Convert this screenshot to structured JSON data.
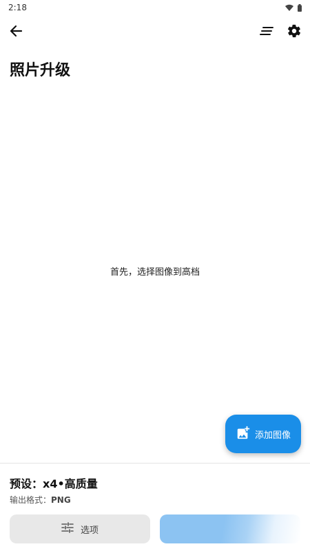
{
  "status_bar": {
    "time": "2:18"
  },
  "app_bar": {
    "back_icon": "arrow-left-icon",
    "sort_icon": "sort-lines-icon",
    "settings_icon": "gear-icon"
  },
  "page": {
    "title": "照片升级",
    "empty_hint": "首先，选择图像到高档"
  },
  "fab": {
    "icon": "add-photo-icon",
    "label": "添加图像",
    "color": "#1a8ee8"
  },
  "bottom_panel": {
    "preset_label": "预设：",
    "preset_value": "x4•高质量",
    "format_label": "输出格式：",
    "format_value": "PNG",
    "options_icon": "tune-icon",
    "options_label": "选项",
    "start_button_color": "#8cc3f2"
  }
}
